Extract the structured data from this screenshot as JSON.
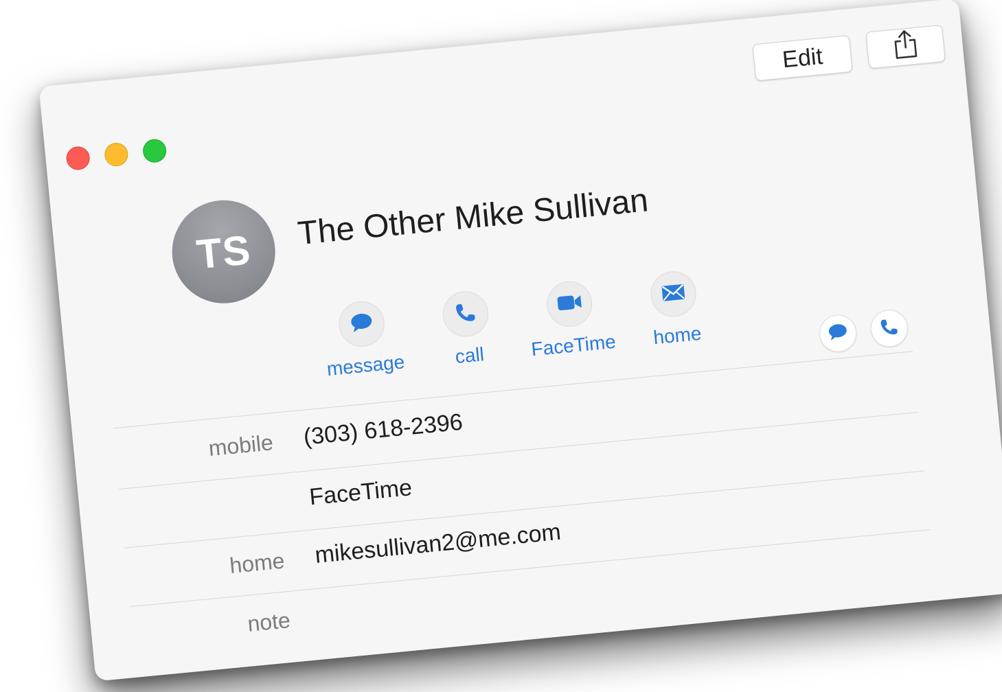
{
  "window": {
    "controls": {
      "close": "close-button",
      "minimize": "minimize-button",
      "zoom": "zoom-button"
    }
  },
  "toolbar": {
    "edit_label": "Edit",
    "share_icon": "share-icon"
  },
  "contact": {
    "initials": "TS",
    "name": "The Other Mike Sullivan"
  },
  "actions": [
    {
      "label": "message",
      "icon": "message-bubble-icon"
    },
    {
      "label": "call",
      "icon": "phone-icon"
    },
    {
      "label": "FaceTime",
      "icon": "video-camera-icon"
    },
    {
      "label": "home",
      "icon": "envelope-icon"
    }
  ],
  "row_actions": [
    {
      "icon": "message-bubble-icon"
    },
    {
      "icon": "phone-icon"
    }
  ],
  "fields": [
    {
      "label": "mobile",
      "value": "(303) 618-2396"
    },
    {
      "label": "",
      "value": "FaceTime"
    },
    {
      "label": "home",
      "value": "mikesullivan2@me.com"
    },
    {
      "label": "note",
      "value": ""
    }
  ],
  "colors": {
    "accent": "#2a7ad9",
    "close": "#fc5b56",
    "minimize": "#fdbc2e",
    "zoom": "#29c840",
    "avatar": "#8a8c93"
  }
}
